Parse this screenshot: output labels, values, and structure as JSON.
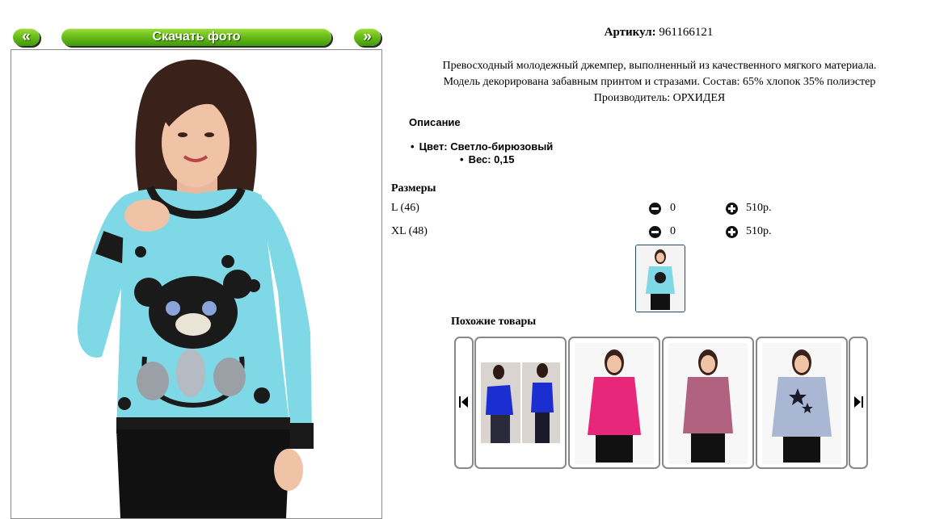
{
  "gallery": {
    "prev_label": "«",
    "next_label": "»",
    "download_label": "Скачать фото"
  },
  "product": {
    "sku_label": "Артикул:",
    "sku_value": "961166121",
    "description_lines": [
      "Превосходный молодежный джемпер, выполненный из качественного мягкого материала.",
      "Модель декорирована забавным принтом и стразами. Состав: 65% хлопок 35% полиэстер",
      "Производитель: ОРХИДЕЯ"
    ],
    "description_title": "Описание",
    "color_bullet": "Цвет: Светло-бирюзовый",
    "weight_bullet": "Вес: 0,15"
  },
  "sizes": {
    "title": "Размеры",
    "rows": [
      {
        "name": "L (46)",
        "qty": "0",
        "price": "510р."
      },
      {
        "name": "XL (48)",
        "qty": "0",
        "price": "510р."
      }
    ]
  },
  "similar": {
    "title": "Похожие товары"
  },
  "icons": {
    "minus": "minus-circle-icon",
    "plus": "plus-circle-icon",
    "carousel_prev": "skip-back-icon",
    "carousel_next": "skip-forward-icon"
  },
  "colors": {
    "button_green": "#6cbf1a",
    "sweater_turquoise": "#7fd8e6",
    "card_pink": "#e8277a",
    "card_mauve": "#b0627e",
    "card_grey_blue": "#aab7d4",
    "card_royal_blue": "#1b2fd1"
  }
}
